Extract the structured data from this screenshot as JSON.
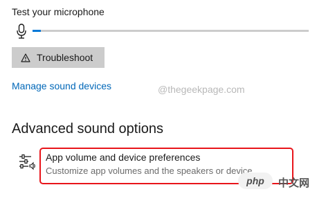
{
  "microphone": {
    "label": "Test your microphone",
    "level": 0.03,
    "icon": "microphone-icon"
  },
  "troubleshoot": {
    "label": "Troubleshoot",
    "icon": "warning-icon"
  },
  "manage_link": "Manage sound devices",
  "watermark": {
    "site": "@thegeekpage.com",
    "badge": "php",
    "text": "中文网"
  },
  "advanced": {
    "title": "Advanced sound options",
    "item": {
      "icon": "sliders-speaker-icon",
      "title": "App volume and device preferences",
      "subtitle": "Customize app volumes and the speakers or device"
    }
  },
  "colors": {
    "accent": "#0078d7",
    "link": "#0067b8",
    "highlight": "#e8141a",
    "button_bg": "#cccccc"
  }
}
